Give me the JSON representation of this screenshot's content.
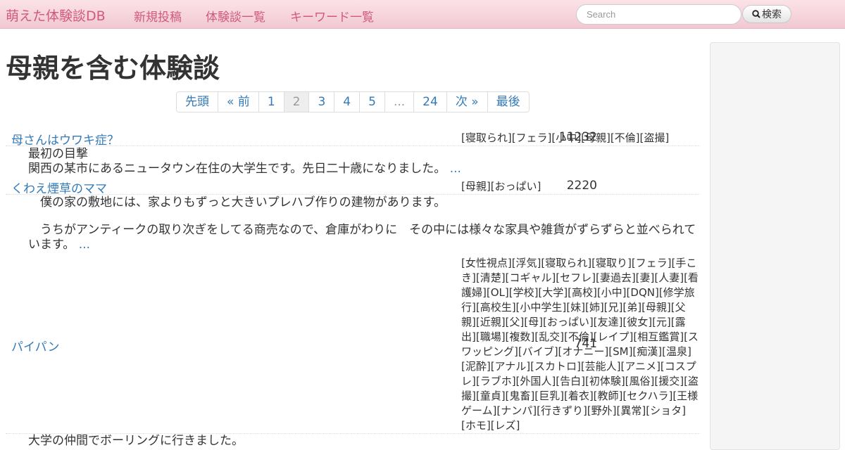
{
  "navbar": {
    "brand": "萌えた体験談DB",
    "links": [
      "新規投稿",
      "体験談一覧",
      "キーワード一覧"
    ],
    "search_placeholder": "Search",
    "search_button": "検索"
  },
  "page_title": "母親を含む体験談",
  "pagination": [
    "先頭",
    "« 前",
    "1",
    "2",
    "3",
    "4",
    "5",
    "...",
    "24",
    "次 »",
    "最後"
  ],
  "pagination_active": "2",
  "entries": [
    {
      "title": "母さんはウワキ症？",
      "count": "11232",
      "tags": "[寝取られ][フェラ][小中][母親][不倫][盗撮]",
      "excerpt_lines": [
        "最初の目撃",
        "関西の某市にあるニュータウン在住の大学生です。先日二十歳になりました。"
      ],
      "more": "..."
    },
    {
      "title": "くわえ煙草のママ",
      "count": "2220",
      "tags": "[母親][おっぱい]",
      "excerpt_lines": [
        "　僕の家の敷地には、家よりもずっと大きいプレハブ作りの建物があります。",
        "",
        "　うちがアンティークの取り次ぎをしてる商売なので、倉庫がわりに　その中には様々な家具や雑貨がずらずらと並べられています。"
      ],
      "more": "..."
    },
    {
      "title": "パイパン",
      "count": "741",
      "tags": "[女性視点][浮気][寝取られ][寝取り][フェラ][手こき][清楚][コギャル][セフレ][妻過去][妻][人妻][看護婦][OL][学校][大学][高校][小中][DQN][修学旅行][高校生][小中学生][妹][姉][兄][弟][母親][父親][近親][父][母][おっぱい][友達][彼女][元][露出][職場][複数][乱交][不倫][レイプ][相互鑑賞][スワッピング][バイブ][オナニー][SM][痴漢][温泉][泥酔][アナル][スカトロ][芸能人][アニメ][コスプレ][ラブホ][外国人][告白][初体験][風俗][援交][盗撮][童貞][鬼畜][巨乳][着衣][教師][セクハラ][王様ゲーム][ナンパ][行きずり][野外][異常][ショタ][ホモ][レズ]",
      "excerpt_lines": [
        "大学の仲間でボーリングに行きました。"
      ],
      "more": ""
    }
  ]
}
